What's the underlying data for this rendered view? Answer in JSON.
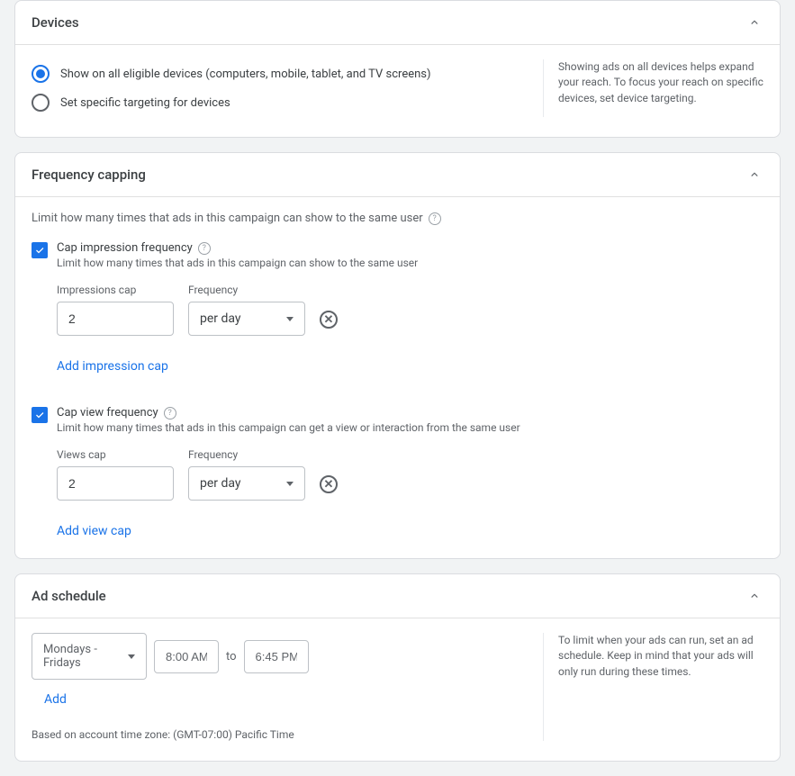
{
  "devices": {
    "title": "Devices",
    "option_all": "Show on all eligible devices (computers, mobile, tablet, and TV screens)",
    "option_specific": "Set specific targeting for devices",
    "side_help": "Showing ads on all devices helps expand your reach. To focus your reach on specific devices, set device targeting."
  },
  "freq": {
    "title": "Frequency capping",
    "intro": "Limit how many times that ads in this campaign can show to the same user",
    "impression": {
      "label": "Cap impression frequency",
      "desc": "Limit how many times that ads in this campaign can show to the same user",
      "cap_label": "Impressions cap",
      "cap_value": "2",
      "freq_label": "Frequency",
      "freq_value": "per day",
      "add_link": "Add impression cap"
    },
    "view": {
      "label": "Cap view frequency",
      "desc": "Limit how many times that ads in this campaign can get a view or interaction from the same user",
      "cap_label": "Views cap",
      "cap_value": "2",
      "freq_label": "Frequency",
      "freq_value": "per day",
      "add_link": "Add view cap"
    }
  },
  "schedule": {
    "title": "Ad schedule",
    "days": "Mondays - Fridays",
    "from": "8:00 AM",
    "to_label": "to",
    "to": "6:45 PM",
    "add": "Add",
    "side_help": "To limit when your ads can run, set an ad schedule. Keep in mind that your ads will only run during these times.",
    "tz": "Based on account time zone: (GMT-07:00) Pacific Time"
  }
}
